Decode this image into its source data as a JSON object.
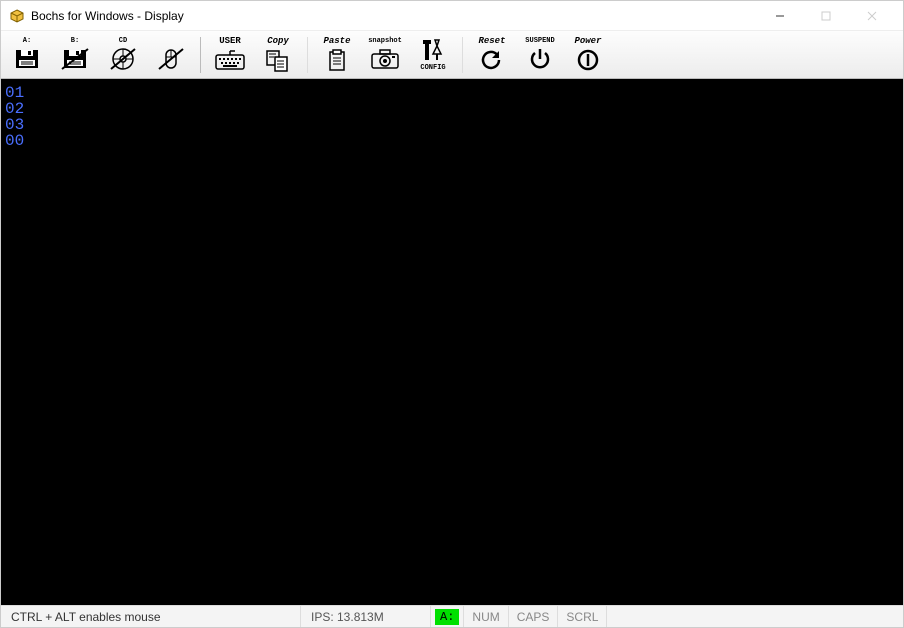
{
  "window": {
    "title": "Bochs for Windows - Display"
  },
  "toolbar": {
    "floppy_a": "A:",
    "floppy_b": "B:",
    "cdrom": "CD",
    "mouse": "",
    "user": "USER",
    "copy": "Copy",
    "paste": "Paste",
    "snapshot": "snapshot",
    "config": "CONFIG",
    "reset": "Reset",
    "suspend": "SUSPEND",
    "power": "Power"
  },
  "display": {
    "lines": [
      "01",
      "02",
      "03",
      "00"
    ]
  },
  "status": {
    "message": "CTRL + ALT enables mouse",
    "ips": "IPS: 13.813M",
    "drive": "A:",
    "locks": {
      "num": "NUM",
      "caps": "CAPS",
      "scrl": "SCRL"
    }
  }
}
